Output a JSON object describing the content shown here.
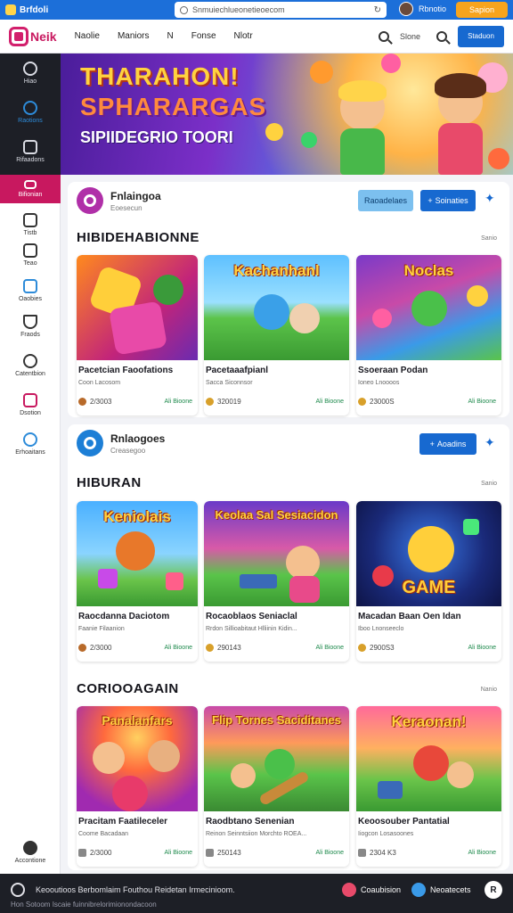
{
  "topbar": {
    "brand": "Brfdoli",
    "url": "Snmuiechlueonetieoecom",
    "reload_icon": "reload-icon",
    "username": "Rbnotio",
    "cta": "Sapion"
  },
  "header": {
    "logo": "Neik",
    "nav": [
      "Naolie",
      "Maniors",
      "N",
      "Fonse",
      "Nlotr"
    ],
    "search_label": "Slone",
    "cta": "Staduon"
  },
  "sidebar": {
    "items": [
      {
        "label": "Hiao",
        "icon": "gear-icon"
      },
      {
        "label": "Raotions",
        "icon": "globe-icon"
      },
      {
        "label": "Rifaadons",
        "icon": "chat-icon"
      },
      {
        "label": "Bifionian",
        "icon": "folder-icon"
      },
      {
        "label": "Tistb",
        "icon": "clock-icon"
      },
      {
        "label": "Teao",
        "icon": "grid-icon"
      },
      {
        "label": "Oaobies",
        "icon": "document-icon"
      },
      {
        "label": "Fraods",
        "icon": "shield-icon"
      },
      {
        "label": "Catentbion",
        "icon": "compass-icon"
      },
      {
        "label": "Dsotion",
        "icon": "gamepad-icon"
      },
      {
        "label": "Erhoaitans",
        "icon": "cloud-icon"
      }
    ],
    "bottom_item": {
      "label": "Accontione",
      "icon": "person-icon"
    }
  },
  "hero": {
    "line1": "THARAHON!",
    "line2": "SPHARARGAS",
    "line3": "SIPIIDEGRIO TOORI"
  },
  "channel1": {
    "name": "Fnlaingoa",
    "sub": "Eoesecun",
    "btn1": "Raoadelaes",
    "btn2": "Soinaties",
    "btn2_icon": "plus-icon",
    "sparkle": "sparkle-icon"
  },
  "section1": {
    "title": "HIBIDEHABIONNE",
    "see_more": "Sanio",
    "cards": [
      {
        "thumb_label": "",
        "title": "Pacetcian Faoofations",
        "sub": "Coon Lacosom",
        "meta": "2/3003",
        "more": "Ali Bioone"
      },
      {
        "thumb_label": "Kachanhanl",
        "title": "Pacetaaafpianl",
        "sub": "Sacca Siconnsor",
        "meta": "320019",
        "more": "Ali Bioone"
      },
      {
        "thumb_label": "Noclas",
        "title": "Ssoeraan Podan",
        "sub": "Ioneo Lnoooos",
        "meta": "23000S",
        "more": "Ali Bioone"
      }
    ]
  },
  "channel2": {
    "name": "Rnlaogoes",
    "sub": "Creasegoo",
    "btn": "Aoadins",
    "btn_icon": "plus-icon",
    "sparkle": "sparkle-icon"
  },
  "section2": {
    "title": "HIBURAN",
    "see_more": "Sanio",
    "cards": [
      {
        "thumb_label": "Keniolais",
        "title": "Raocdanna Daciotom",
        "sub": "Faanie Filaanion",
        "meta": "2/3000",
        "more": "Ali Bioone"
      },
      {
        "thumb_label": "Keolaa Sal Sesiacidon",
        "title": "Rocaoblaos Seniaclal",
        "sub": "Rrdon Sillioabitaut Hlliinin Kidin...",
        "meta": "290143",
        "more": "Ali Bioone"
      },
      {
        "thumb_label": "GAME",
        "title": "Macadan Baan Oen Idan",
        "sub": "Iboo Lnonseeclo",
        "meta": "2900S3",
        "more": "Ali Bioone"
      }
    ]
  },
  "section3": {
    "title": "CORIOOAGAIN",
    "see_more": "Nanio",
    "cards": [
      {
        "thumb_label": "Panalanfars",
        "title": "Pracitam Faatileceler",
        "sub": "Coome Bacadaan",
        "meta": "2/3000",
        "more": "Ali Bioone"
      },
      {
        "thumb_label": "Flip Tornes Saciditanes",
        "title": "Raodbtano Senenian",
        "sub": "Reinon Seinntsiion Morchto ROEA...",
        "meta": "250143",
        "more": "Ali Bioone"
      },
      {
        "thumb_label": "Keraonan!",
        "title": "Keoosouber Pantatial",
        "sub": "Iiogcon Losasoones",
        "meta": "2304 K3",
        "more": "Ali Bioone"
      }
    ]
  },
  "bottombar": {
    "text": "Keooutioos Berbomlaim Fouthou Reidetan Irmecinioom.",
    "text2": "Hon  Sotoom Iscaie fuinnibrelorimionondacoon",
    "item1": "Coaubision",
    "item2": "Neoatecets",
    "close_icon": "close-icon"
  },
  "colors": {
    "accent": "#c8185f",
    "primary": "#1769d0",
    "warning": "#f7a41d"
  }
}
